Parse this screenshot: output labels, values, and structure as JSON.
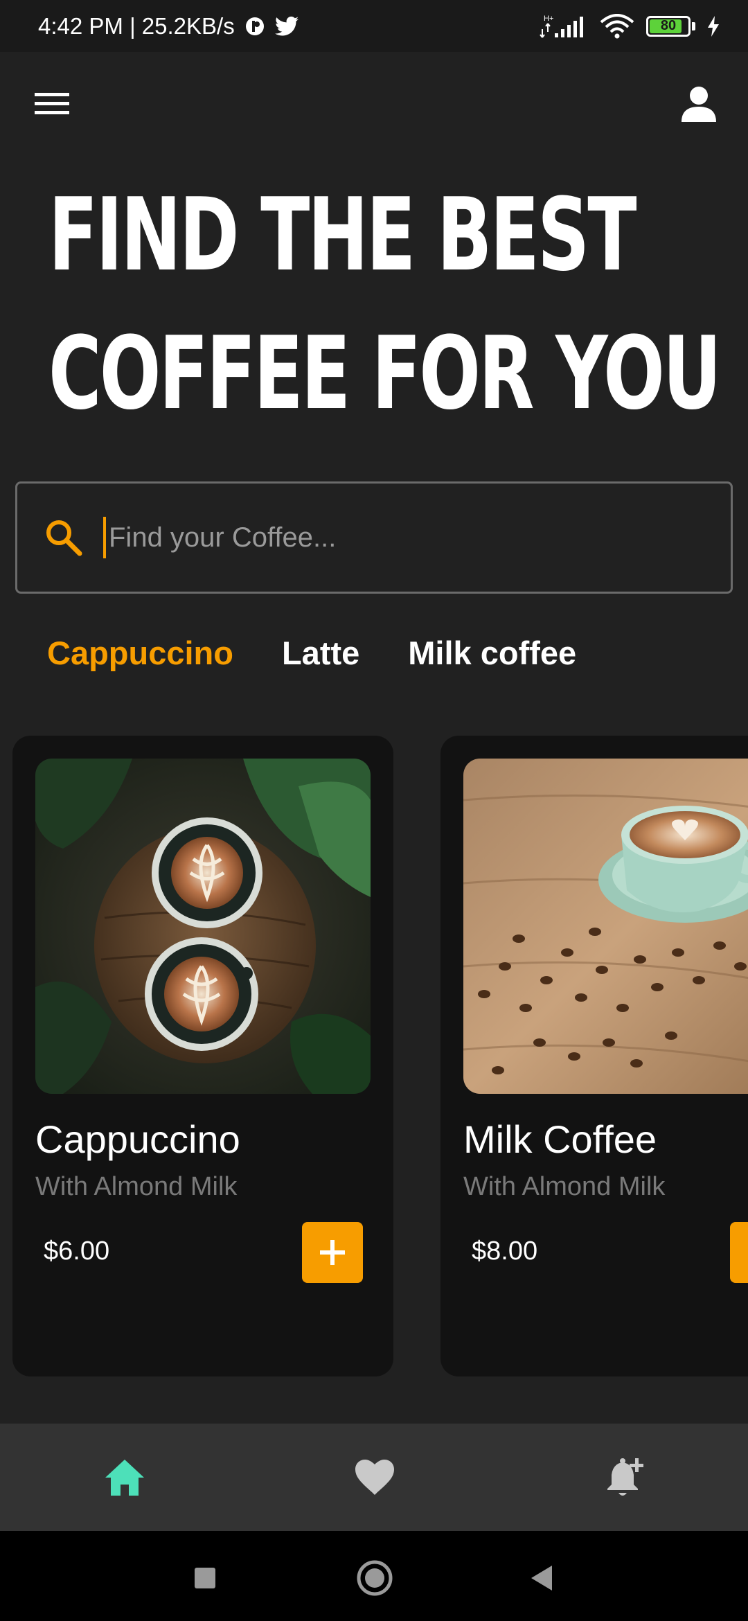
{
  "status_bar": {
    "left_text": "4:42 PM | 25.2KB/s",
    "network_label": "H+",
    "battery_level": "80"
  },
  "app_bar": {
    "menu_icon": "hamburger-menu-icon",
    "profile_icon": "user-profile-icon"
  },
  "headline": {
    "line1": "FIND THE BEST",
    "line2": "COFFEE FOR YOU"
  },
  "search": {
    "placeholder": "Find your Coffee...",
    "value": ""
  },
  "tabs": [
    {
      "label": "Cappuccino",
      "active": true
    },
    {
      "label": "Latte",
      "active": false
    },
    {
      "label": "Milk coffee",
      "active": false
    }
  ],
  "cards": [
    {
      "title": "Cappuccino",
      "subtitle": "With Almond Milk",
      "price": "$6.00"
    },
    {
      "title": "Milk Coffee",
      "subtitle": "With Almond Milk",
      "price": "$8.00"
    }
  ],
  "bottom_nav": [
    {
      "icon": "home-icon",
      "active": true
    },
    {
      "icon": "heart-icon",
      "active": false
    },
    {
      "icon": "bell-add-icon",
      "active": false
    }
  ],
  "colors": {
    "accent": "#f79d00",
    "active_nav": "#4de0b9",
    "background": "#212121",
    "card": "#121212"
  }
}
